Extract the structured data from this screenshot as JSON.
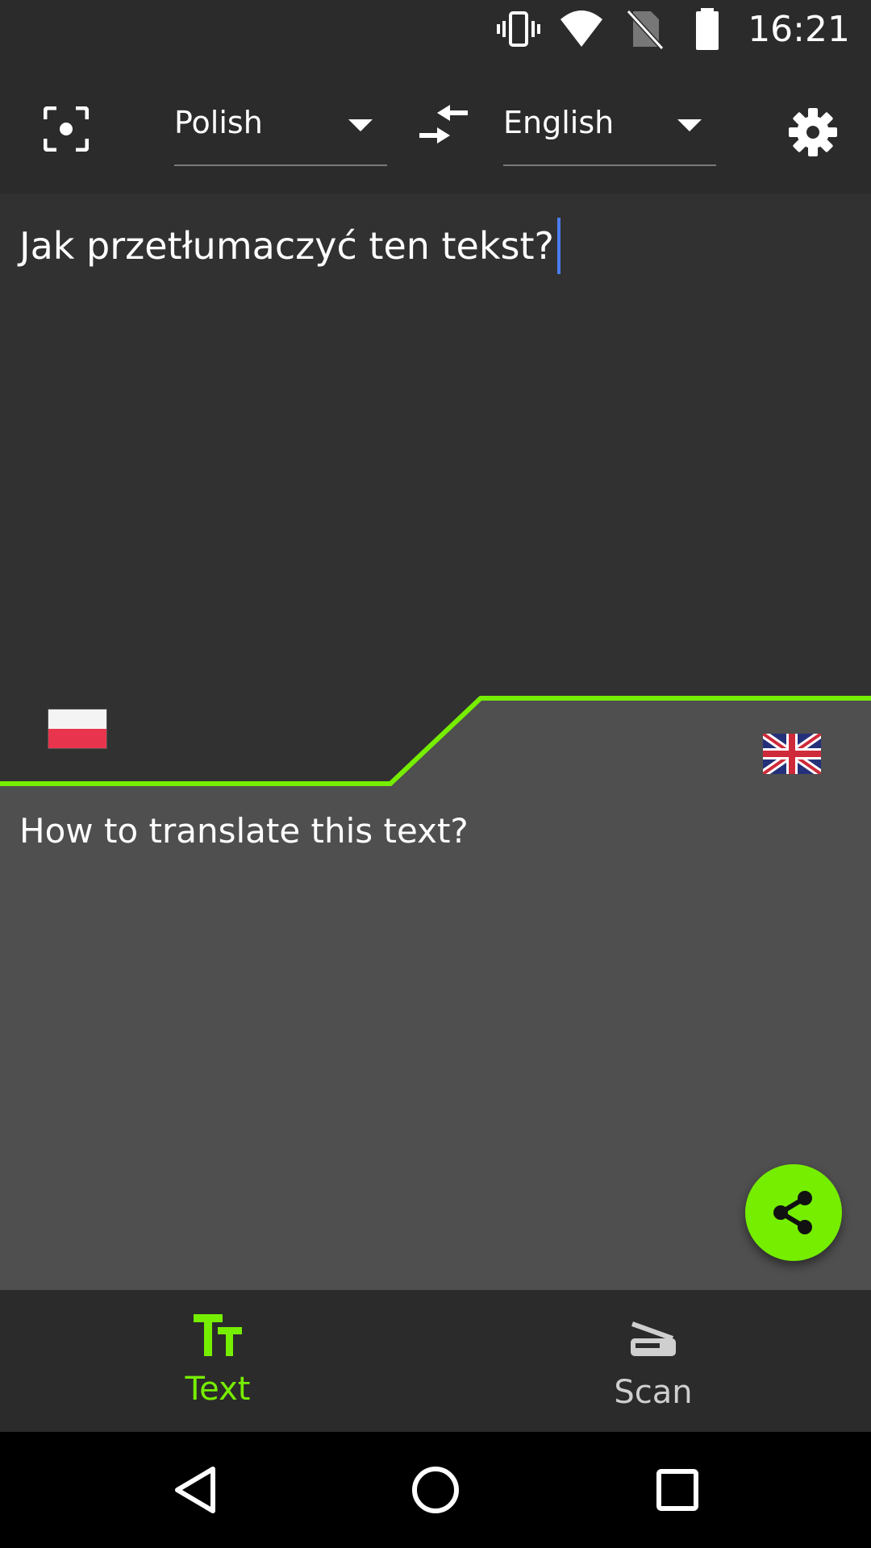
{
  "status_bar": {
    "time": "16:21",
    "icons": [
      "vibrate-icon",
      "wifi-icon",
      "no-sim-icon",
      "battery-icon"
    ]
  },
  "toolbar": {
    "scan_icon": "focus-scan-icon",
    "source_language": "Polish",
    "swap_icon": "swap-arrows-icon",
    "target_language": "English",
    "settings_icon": "gear-icon"
  },
  "source": {
    "text": "Jak przetłumaczyć ten tekst?",
    "flag": "poland-flag"
  },
  "target": {
    "text": "How to translate this text?",
    "flag": "uk-flag"
  },
  "fab": {
    "icon": "share-icon"
  },
  "bottom_nav": {
    "items": [
      {
        "label": "Text",
        "icon": "text-size-icon",
        "active": true
      },
      {
        "label": "Scan",
        "icon": "scanner-icon",
        "active": false
      }
    ]
  },
  "colors": {
    "accent": "#76ee00",
    "toolbar_bg": "#2b2b2b",
    "source_bg": "#313131",
    "target_bg": "#4f4f4f",
    "cursor": "#4a7cf0"
  }
}
